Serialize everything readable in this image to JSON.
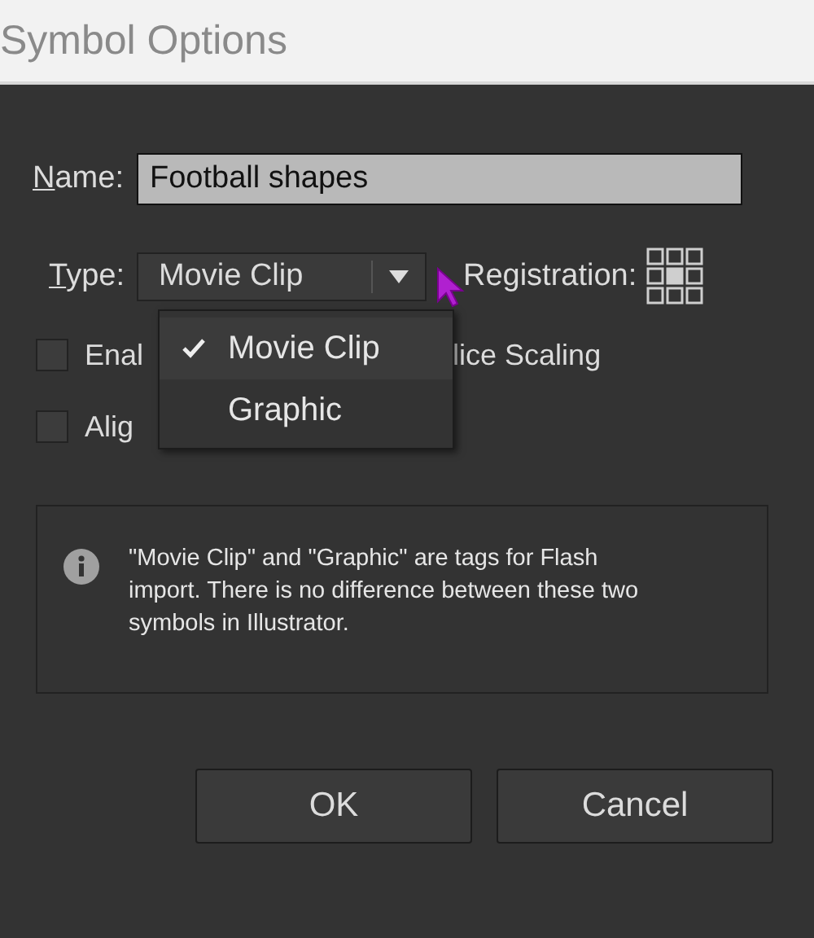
{
  "window": {
    "title": "Symbol Options"
  },
  "name_field": {
    "label": "Name:",
    "value": "Football shapes"
  },
  "type_field": {
    "label": "Type:",
    "value": "Movie Clip",
    "expanded": true,
    "options": [
      {
        "label": "Movie Clip",
        "selected": true
      },
      {
        "label": "Graphic",
        "selected": false
      }
    ]
  },
  "registration": {
    "label": "Registration:"
  },
  "checkboxes": [
    {
      "checked": false,
      "label_start": "Enal",
      "label_end": "lice Scaling"
    },
    {
      "checked": false,
      "label_start": "Alig"
    }
  ],
  "info": "\"Movie Clip\" and \"Graphic\" are tags for Flash import. There is no difference between these two symbols in Illustrator.",
  "buttons": [
    "OK",
    "Cancel"
  ]
}
